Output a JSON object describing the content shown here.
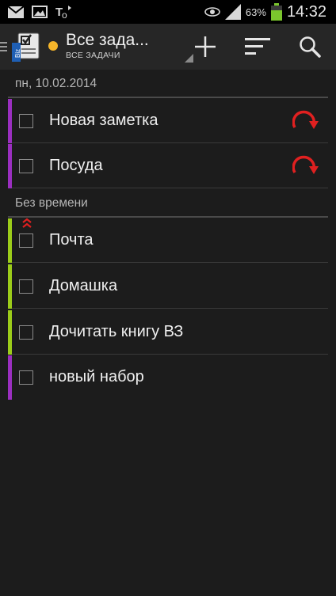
{
  "status_bar": {
    "icons": [
      "mail-icon",
      "image-icon",
      "tasks-sync-icon",
      "eye-icon",
      "signal-icon",
      "battery-icon"
    ],
    "battery_percent": "63%",
    "time": "14:32"
  },
  "action_bar": {
    "title": "Все зада...",
    "subtitle": "ВСЕ ЗАДАЧИ",
    "sync_status_color": "#f5b52a",
    "buttons": [
      "add-icon",
      "sort-icon",
      "search-icon"
    ]
  },
  "sections": [
    {
      "header": "пн, 10.02.2014",
      "tasks": [
        {
          "title": "Новая заметка",
          "color": "#9b2fc0",
          "repeat": true,
          "priority": false
        },
        {
          "title": "Посуда",
          "color": "#9b2fc0",
          "repeat": true,
          "priority": false
        }
      ]
    },
    {
      "header": "Без времени",
      "tasks": [
        {
          "title": "Почта",
          "color": "#9ccc1a",
          "repeat": false,
          "priority": true
        },
        {
          "title": "Домашка",
          "color": "#9ccc1a",
          "repeat": false,
          "priority": false
        },
        {
          "title": "Дочитать книгу ВЗ",
          "color": "#9ccc1a",
          "repeat": false,
          "priority": false
        },
        {
          "title": "новый набор",
          "color": "#9b2fc0",
          "repeat": false,
          "priority": false
        }
      ]
    }
  ],
  "colors": {
    "repeat_icon": "#e02020",
    "priority_icon": "#e02020"
  }
}
